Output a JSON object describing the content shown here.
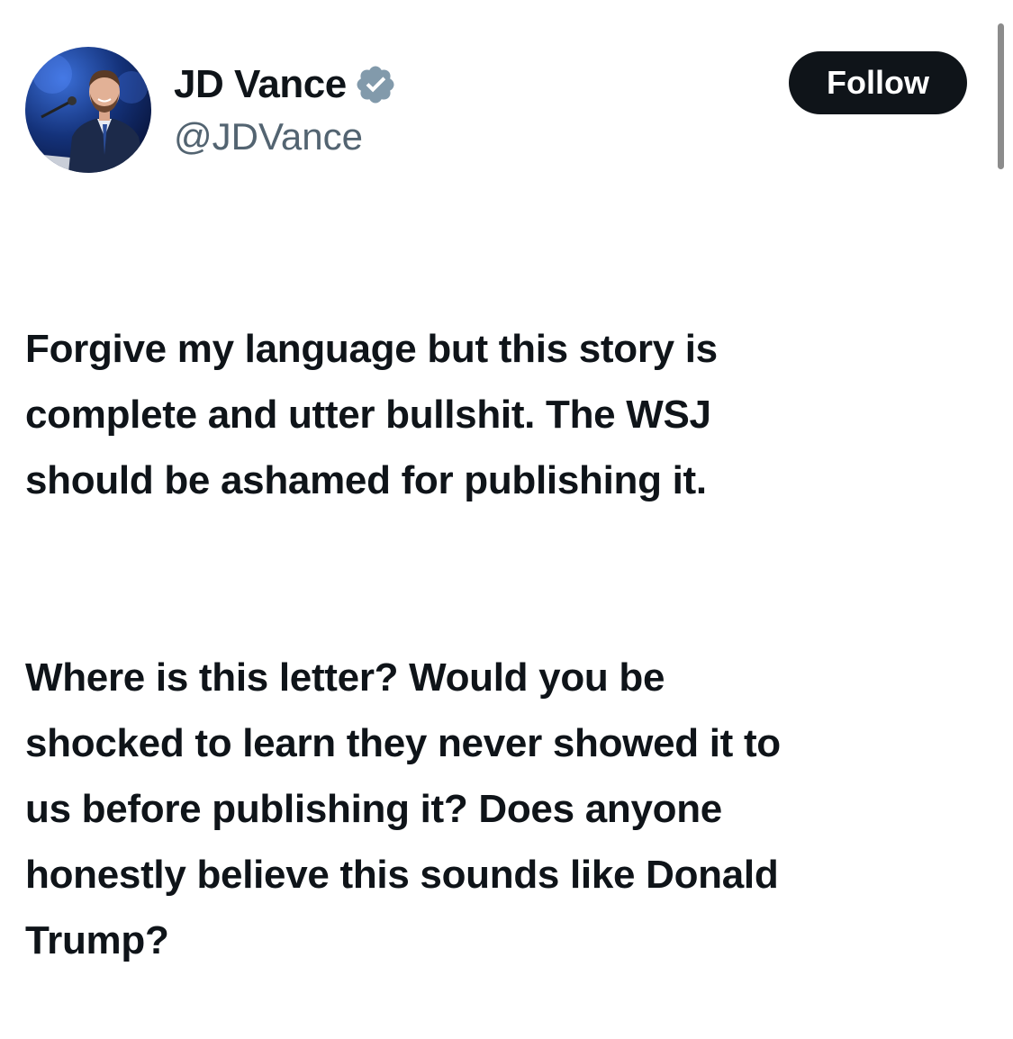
{
  "author": {
    "display_name": "JD Vance",
    "handle": "@JDVance",
    "verified": true,
    "verified_badge_color": "#829aab",
    "avatar_icon": "profile-photo"
  },
  "actions": {
    "follow_label": "Follow"
  },
  "tweet": {
    "paragraphs": [
      "Forgive my language but this story is\ncomplete and utter bullshit. The WSJ\nshould be ashamed for publishing it.",
      "Where is this letter? Would you be\nshocked to learn they never showed it to\nus before publishing it? Does anyone\nhonestly believe this sounds like Donald\nTrump?"
    ]
  },
  "colors": {
    "text_primary": "#0f1419",
    "text_secondary": "#536471",
    "button_bg": "#0f1419",
    "button_text": "#ffffff"
  }
}
